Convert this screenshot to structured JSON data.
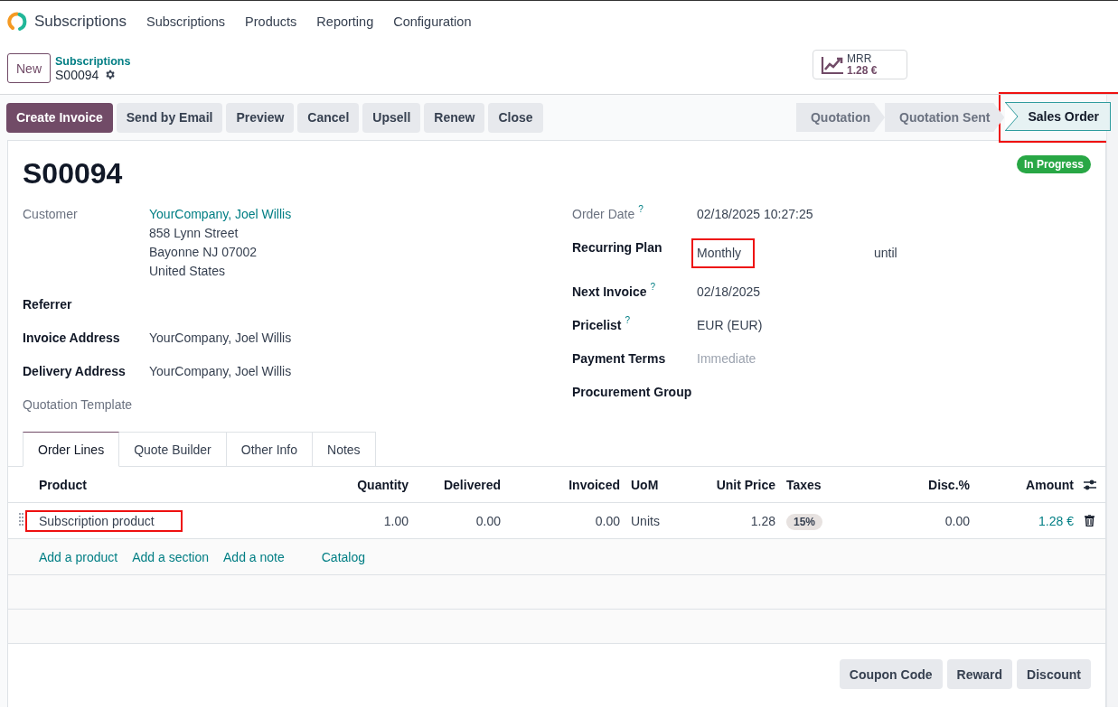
{
  "app": {
    "name": "Subscriptions",
    "menu": [
      "Subscriptions",
      "Products",
      "Reporting",
      "Configuration"
    ]
  },
  "control_panel": {
    "new_button": "New",
    "breadcrumb": "Subscriptions",
    "record": "S00094",
    "mrr": {
      "label": "MRR",
      "value": "1.28 €"
    }
  },
  "actions": [
    {
      "label": "Create Invoice",
      "primary": true
    },
    {
      "label": "Send by Email",
      "primary": false
    },
    {
      "label": "Preview",
      "primary": false
    },
    {
      "label": "Cancel",
      "primary": false
    },
    {
      "label": "Upsell",
      "primary": false
    },
    {
      "label": "Renew",
      "primary": false
    },
    {
      "label": "Close",
      "primary": false
    }
  ],
  "stages": [
    {
      "label": "Quotation",
      "selected": false,
      "highlighted": false
    },
    {
      "label": "Quotation Sent",
      "selected": false,
      "highlighted": false
    },
    {
      "label": "Sales Order",
      "selected": true,
      "highlighted": true
    }
  ],
  "form": {
    "name": "S00094",
    "status": "In Progress",
    "left_fields": [
      {
        "label": "Customer",
        "bold": false,
        "value": "YourCompany, Joel Willis",
        "link": true,
        "lines": [
          "858 Lynn Street",
          "Bayonne NJ 07002",
          "United States"
        ]
      },
      {
        "label": "Referrer",
        "bold": true
      },
      {
        "label": "Invoice Address",
        "bold": true,
        "value": "YourCompany, Joel Willis",
        "link": false
      },
      {
        "label": "Delivery Address",
        "bold": true,
        "value": "YourCompany, Joel Willis",
        "link": false
      },
      {
        "label": "Quotation Template",
        "bold": false
      }
    ],
    "right_fields": [
      {
        "label": "Order Date",
        "bold": false,
        "help": "?",
        "value": "02/18/2025 10:27:25",
        "link": false
      },
      {
        "label": "Recurring Plan",
        "bold": true,
        "value": "Monthly",
        "link": false,
        "highlighted": true,
        "suffix": "until"
      },
      {
        "label": "Next Invoice",
        "bold": true,
        "help": "?",
        "value": "02/18/2025",
        "link": false
      },
      {
        "label": "Pricelist",
        "bold": true,
        "help": "?",
        "value": "EUR (EUR)",
        "link": false
      },
      {
        "label": "Payment Terms",
        "bold": true,
        "placeholder": "Immediate"
      },
      {
        "label": "Procurement Group",
        "bold": true
      }
    ]
  },
  "tabs": [
    {
      "label": "Order Lines",
      "selected": true
    },
    {
      "label": "Quote Builder",
      "selected": false
    },
    {
      "label": "Other Info",
      "selected": false
    },
    {
      "label": "Notes",
      "selected": false
    }
  ],
  "table": {
    "columns": [
      "Product",
      "Quantity",
      "Delivered",
      "Invoiced",
      "UoM",
      "Unit Price",
      "Taxes",
      "Disc.%",
      "Amount"
    ],
    "rows": [
      {
        "highlighted": true,
        "cells": [
          {
            "kind": "text",
            "text": "Subscription product"
          },
          {
            "kind": "text",
            "text": "1.00"
          },
          {
            "kind": "text",
            "text": "0.00"
          },
          {
            "kind": "text",
            "text": "0.00"
          },
          {
            "kind": "text",
            "text": "Units"
          },
          {
            "kind": "text",
            "text": "1.28"
          },
          {
            "kind": "tag",
            "text": "15%"
          },
          {
            "kind": "text",
            "text": "0.00"
          },
          {
            "kind": "link",
            "text": "1.28 €"
          }
        ]
      }
    ],
    "add_links": [
      "Add a product",
      "Add a section",
      "Add a note",
      "Catalog"
    ]
  },
  "buttons": [
    "Coupon Code",
    "Reward",
    "Discount"
  ]
}
